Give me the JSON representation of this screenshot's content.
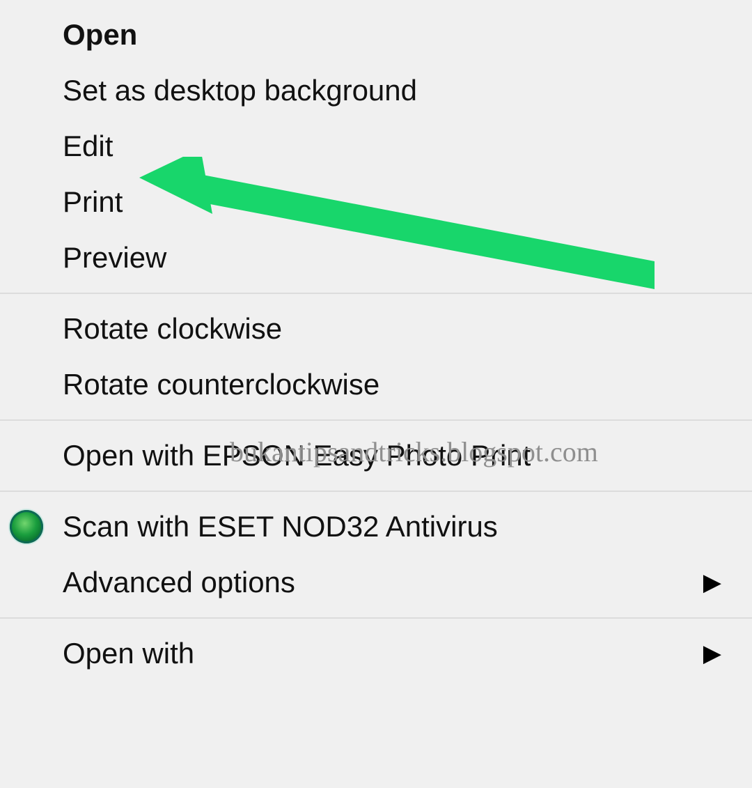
{
  "menu": {
    "groups": [
      {
        "items": [
          {
            "key": "open",
            "label": "Open",
            "bold": true,
            "submenu": false,
            "icon": null
          },
          {
            "key": "set-bg",
            "label": "Set as desktop background",
            "bold": false,
            "submenu": false,
            "icon": null
          },
          {
            "key": "edit",
            "label": "Edit",
            "bold": false,
            "submenu": false,
            "icon": null
          },
          {
            "key": "print",
            "label": "Print",
            "bold": false,
            "submenu": false,
            "icon": null
          },
          {
            "key": "preview",
            "label": "Preview",
            "bold": false,
            "submenu": false,
            "icon": null
          }
        ]
      },
      {
        "items": [
          {
            "key": "rotate-cw",
            "label": "Rotate clockwise",
            "bold": false,
            "submenu": false,
            "icon": null
          },
          {
            "key": "rotate-ccw",
            "label": "Rotate counterclockwise",
            "bold": false,
            "submenu": false,
            "icon": null
          }
        ]
      },
      {
        "items": [
          {
            "key": "epson-print",
            "label": "Open with EPSON Easy Photo Print",
            "bold": false,
            "submenu": false,
            "icon": null
          }
        ]
      },
      {
        "items": [
          {
            "key": "eset-scan",
            "label": "Scan with ESET NOD32 Antivirus",
            "bold": false,
            "submenu": false,
            "icon": "eset"
          },
          {
            "key": "advanced",
            "label": "Advanced options",
            "bold": false,
            "submenu": true,
            "icon": null
          }
        ]
      },
      {
        "items": [
          {
            "key": "open-with",
            "label": "Open with",
            "bold": false,
            "submenu": true,
            "icon": null
          }
        ]
      }
    ]
  },
  "annotation": {
    "watermark_text": "bukantipsandtricks.blogspot.com",
    "arrow_target": "print",
    "arrow_color": "#18d66b"
  }
}
